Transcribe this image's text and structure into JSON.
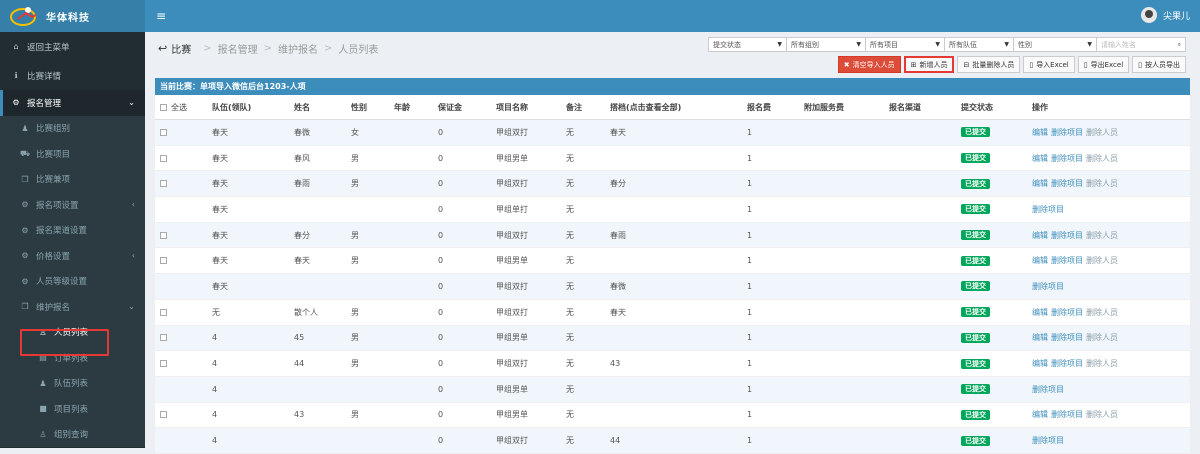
{
  "app": {
    "logo_text": "华体科技",
    "user_name": "尖果儿"
  },
  "sidebar": {
    "items": [
      {
        "label": "返回主菜单",
        "icon": "home-icon",
        "glyph": "⌂"
      },
      {
        "label": "比赛详情",
        "icon": "info-icon",
        "glyph": "ℹ"
      },
      {
        "label": "报名管理",
        "icon": "cogs-icon",
        "glyph": "⚙"
      },
      {
        "label": "比赛组别",
        "icon": "user-icon",
        "glyph": "♟"
      },
      {
        "label": "比赛项目",
        "icon": "car-icon",
        "glyph": "⛟"
      },
      {
        "label": "比赛兼项",
        "icon": "copy-icon",
        "glyph": "❐"
      },
      {
        "label": "报名项设置",
        "icon": "gear-icon",
        "glyph": "⚙"
      },
      {
        "label": "报名渠道设置",
        "icon": "gear-icon",
        "glyph": "⚙"
      },
      {
        "label": "价格设置",
        "icon": "gear-icon",
        "glyph": "⚙"
      },
      {
        "label": "人员等级设置",
        "icon": "gear-icon",
        "glyph": "⚙"
      },
      {
        "label": "维护报名",
        "icon": "copy-icon",
        "glyph": "❐"
      },
      {
        "label": "人员列表",
        "icon": "person-icon",
        "glyph": "♙"
      },
      {
        "label": "订单列表",
        "icon": "list-icon",
        "glyph": "▤"
      },
      {
        "label": "队伍列表",
        "icon": "users-icon",
        "glyph": "♟"
      },
      {
        "label": "项目列表",
        "icon": "square-icon",
        "glyph": "■"
      },
      {
        "label": "组别查询",
        "icon": "person-icon",
        "glyph": "♙"
      }
    ]
  },
  "breadcrumb": {
    "items": [
      "比赛",
      "报名管理",
      "维护报名",
      "人员列表"
    ]
  },
  "filters": [
    {
      "label": "提交状态"
    },
    {
      "label": "所有组别"
    },
    {
      "label": "所有项目"
    },
    {
      "label": "所有队伍"
    },
    {
      "label": "性别"
    }
  ],
  "search": {
    "placeholder": "请输入姓名"
  },
  "buttons": [
    {
      "label": "清空导入人员",
      "icon": "times-icon",
      "glyph": "✖"
    },
    {
      "label": "新增人员",
      "icon": "plus-square-icon",
      "glyph": "⊞"
    },
    {
      "label": "批量删除人员",
      "icon": "minus-square-icon",
      "glyph": "⊟"
    },
    {
      "label": "导入Excel",
      "icon": "file-icon",
      "glyph": "▯"
    },
    {
      "label": "导出Excel",
      "icon": "file-icon",
      "glyph": "▯"
    },
    {
      "label": "按人员导出",
      "icon": "file-icon",
      "glyph": "▯"
    }
  ],
  "current_match": "当前比赛：单项导入微信后台1203-人项",
  "table": {
    "headers": [
      "全选",
      "队伍(领队)",
      "姓名",
      "性别",
      "年龄",
      "保证金",
      "项目名称",
      "备注",
      "搭档(点击查看全部)",
      "报名费",
      "附加服务费",
      "报名渠道",
      "提交状态",
      "操作"
    ],
    "rows": [
      {
        "check": true,
        "team": "春天",
        "name": "春微",
        "gender": "女",
        "age": "",
        "deposit": "0",
        "project": "甲组双打",
        "remark": "无",
        "partner": "春天",
        "fee": "1",
        "status": "已提交",
        "ops": [
          "编辑",
          "删除项目",
          "删除人员"
        ]
      },
      {
        "check": true,
        "team": "春天",
        "name": "春风",
        "gender": "男",
        "age": "",
        "deposit": "0",
        "project": "甲组男单",
        "remark": "无",
        "partner": "",
        "fee": "1",
        "status": "已提交",
        "ops": [
          "编辑",
          "删除项目",
          "删除人员"
        ]
      },
      {
        "check": true,
        "team": "春天",
        "name": "春雨",
        "gender": "男",
        "age": "",
        "deposit": "0",
        "project": "甲组双打",
        "remark": "无",
        "partner": "春分",
        "fee": "1",
        "status": "已提交",
        "ops": [
          "编辑",
          "删除项目",
          "删除人员"
        ]
      },
      {
        "check": false,
        "team": "春天",
        "name": "",
        "gender": "",
        "age": "",
        "deposit": "0",
        "project": "甲组单打",
        "remark": "无",
        "partner": "",
        "fee": "1",
        "status": "已提交",
        "ops": [
          "删除项目"
        ]
      },
      {
        "check": true,
        "team": "春天",
        "name": "春分",
        "gender": "男",
        "age": "",
        "deposit": "0",
        "project": "甲组双打",
        "remark": "无",
        "partner": "春雨",
        "fee": "1",
        "status": "已提交",
        "ops": [
          "编辑",
          "删除项目",
          "删除人员"
        ]
      },
      {
        "check": true,
        "team": "春天",
        "name": "春天",
        "gender": "男",
        "age": "",
        "deposit": "0",
        "project": "甲组男单",
        "remark": "无",
        "partner": "",
        "fee": "1",
        "status": "已提交",
        "ops": [
          "编辑",
          "删除项目",
          "删除人员"
        ]
      },
      {
        "check": false,
        "team": "春天",
        "name": "",
        "gender": "",
        "age": "",
        "deposit": "0",
        "project": "甲组双打",
        "remark": "无",
        "partner": "春微",
        "fee": "1",
        "status": "已提交",
        "ops": [
          "删除项目"
        ]
      },
      {
        "check": true,
        "team": "无",
        "name": "散个人",
        "gender": "男",
        "age": "",
        "deposit": "0",
        "project": "甲组双打",
        "remark": "无",
        "partner": "春天",
        "fee": "1",
        "status": "已提交",
        "ops": [
          "编辑",
          "删除项目",
          "删除人员"
        ]
      },
      {
        "check": true,
        "team": "4",
        "name": "45",
        "gender": "男",
        "age": "",
        "deposit": "0",
        "project": "甲组男单",
        "remark": "无",
        "partner": "",
        "fee": "1",
        "status": "已提交",
        "ops": [
          "编辑",
          "删除项目",
          "删除人员"
        ]
      },
      {
        "check": true,
        "team": "4",
        "name": "44",
        "gender": "男",
        "age": "",
        "deposit": "0",
        "project": "甲组双打",
        "remark": "无",
        "partner": "43",
        "fee": "1",
        "status": "已提交",
        "ops": [
          "编辑",
          "删除项目",
          "删除人员"
        ]
      },
      {
        "check": false,
        "team": "4",
        "name": "",
        "gender": "",
        "age": "",
        "deposit": "0",
        "project": "甲组男单",
        "remark": "无",
        "partner": "",
        "fee": "1",
        "status": "已提交",
        "ops": [
          "删除项目"
        ]
      },
      {
        "check": true,
        "team": "4",
        "name": "43",
        "gender": "男",
        "age": "",
        "deposit": "0",
        "project": "甲组男单",
        "remark": "无",
        "partner": "",
        "fee": "1",
        "status": "已提交",
        "ops": [
          "编辑",
          "删除项目",
          "删除人员"
        ]
      },
      {
        "check": false,
        "team": "4",
        "name": "",
        "gender": "",
        "age": "",
        "deposit": "0",
        "project": "甲组双打",
        "remark": "无",
        "partner": "44",
        "fee": "1",
        "status": "已提交",
        "ops": [
          "删除项目"
        ]
      }
    ]
  },
  "colors": {
    "topbar": "#3c8dbc",
    "sidebar": "#222d32",
    "accent_red": "#dd4b39",
    "status_green": "#00a65a"
  }
}
